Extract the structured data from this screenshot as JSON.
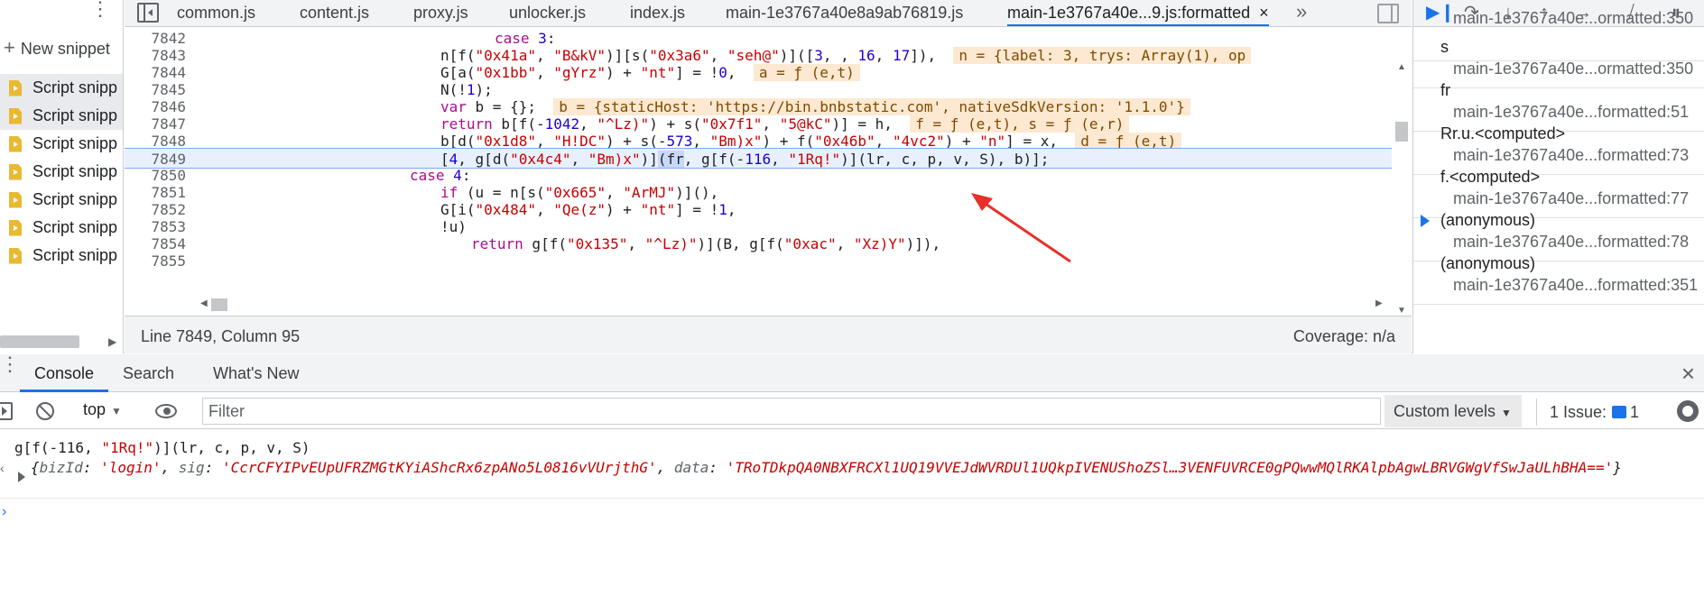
{
  "snippets": {
    "new_label": "New snippet",
    "items": [
      "Script snipp",
      "Script snipp",
      "Script snipp",
      "Script snipp",
      "Script snipp",
      "Script snipp",
      "Script snipp"
    ]
  },
  "editor": {
    "tabs": [
      {
        "label": "common.js"
      },
      {
        "label": "content.js"
      },
      {
        "label": "proxy.js"
      },
      {
        "label": "unlocker.js"
      },
      {
        "label": "index.js"
      },
      {
        "label": "main-1e3767a40e8a9ab76819.js"
      },
      {
        "label": "main-1e3767a40e...9.js:formatted",
        "active": true
      }
    ],
    "tab_close": "×",
    "tab_more": "»",
    "lines": [
      {
        "n": "7842",
        "indent": 21
      },
      {
        "n": "7843",
        "indent": 23
      },
      {
        "n": "7844",
        "indent": 23
      },
      {
        "n": "7845",
        "indent": 23
      },
      {
        "n": "7846",
        "indent": 23
      },
      {
        "n": "7847",
        "indent": 23
      },
      {
        "n": "7848",
        "indent": 23
      },
      {
        "n": "7849",
        "indent": 23
      },
      {
        "n": "7850",
        "indent": 21
      },
      {
        "n": "7851",
        "indent": 23
      },
      {
        "n": "7852",
        "indent": 23
      },
      {
        "n": "7853",
        "indent": 23
      },
      {
        "n": "7854",
        "indent": 25
      },
      {
        "n": "7855",
        "indent": 23
      }
    ],
    "code": {
      "l7842": {
        "kw": "case",
        "num": "3",
        "rest": ":"
      },
      "l7843": {
        "a": "n[f(",
        "s1": "\"0x41a\"",
        "b": ", ",
        "s2": "\"B&kV\"",
        "c": ")][s(",
        "s3": "\"0x3a6\"",
        "d": ", ",
        "s4": "\"seh@\"",
        "e": ")]([",
        "n1": "3",
        "f": ", , ",
        "n2": "16",
        "g": ", ",
        "n3": "17",
        "h": "]),  ",
        "inline": "n = {label: 3, trys: Array(1), op"
      },
      "l7844": {
        "a": "G[a(",
        "s1": "\"0x1bb\"",
        "b": ", ",
        "s2": "\"gYrz\"",
        "c": ") + ",
        "s3": "\"nt\"",
        "d": "] = !",
        "n1": "0",
        "e": ",  ",
        "inline": "a = ƒ (e,t)"
      },
      "l7845": {
        "a": "N(!",
        "n1": "1",
        "b": ");"
      },
      "l7846": {
        "kw": "var",
        "a": " b = {};  ",
        "inline": "b = {staticHost: 'https://bin.bnbstatic.com', nativeSdkVersion: '1.1.0'}"
      },
      "l7847": {
        "kw": "return",
        "a": " b[f(-",
        "n1": "1042",
        "b": ", ",
        "s1": "\"^Lz)\"",
        "c": ") + s(",
        "s2": "\"0x7f1\"",
        "d": ", ",
        "s3": "\"5@kC\"",
        "e": ")] = h,  ",
        "inline": "f = ƒ (e,t), s = ƒ (e,r)"
      },
      "l7848": {
        "a": "b[d(",
        "s1": "\"0x1d8\"",
        "b": ", ",
        "s2": "\"H!DC\"",
        "c": ") + s(-",
        "n1": "573",
        "d": ", ",
        "s3": "\"Bm)x\"",
        "e": ") + f(",
        "s4": "\"0x46b\"",
        "f": ", ",
        "s5": "\"4vc2\"",
        "g": ") + ",
        "s6": "\"n\"",
        "h": "] = x,  ",
        "inline": "d = ƒ (e,t)"
      },
      "l7849": {
        "a": "[",
        "n1": "4",
        "b": ", g[d(",
        "s1": "\"0x4c4\"",
        "c": ", ",
        "s2": "\"Bm)x\"",
        "d": ")]",
        "sel": "(fr",
        "e": ", g[f(-",
        "n2": "116",
        "f": ", ",
        "s3": "\"1Rq!\"",
        "g": ")](lr, c, p, v, S), b)];"
      },
      "l7850": {
        "kw": "case",
        "num": "4",
        "rest": ":"
      },
      "l7851": {
        "kw": "if",
        "a": " (u = n[s(",
        "s1": "\"0x665\"",
        "b": ", ",
        "s2": "\"ArMJ\"",
        "c": ")](),"
      },
      "l7852": {
        "a": "G[i(",
        "s1": "\"0x484\"",
        "b": ", ",
        "s2": "\"Qe(z\"",
        "c": ") + ",
        "s3": "\"nt\"",
        "d": "] = !",
        "n1": "1",
        "e": ","
      },
      "l7853": {
        "a": "!u)"
      },
      "l7854": {
        "kw": "return",
        "a": " g[f(",
        "s1": "\"0x135\"",
        "b": ", ",
        "s2": "\"^Lz)\"",
        "c": ")](B, g[f(",
        "s3": "\"0xac\"",
        "d": ", ",
        "s4": "\"Xz)Y\"",
        "e": ")]),"
      },
      "l7855": {
        "a": ""
      }
    },
    "status_position": "Line 7849, Column 95",
    "status_coverage": "Coverage: n/a"
  },
  "callstack": {
    "frames": [
      {
        "name": "",
        "loc": "main-1e3767a40e...ormatted:350"
      },
      {
        "name": "s",
        "loc": "main-1e3767a40e...ormatted:350"
      },
      {
        "name": "fr",
        "loc": "main-1e3767a40e...formatted:51"
      },
      {
        "name": "Rr.u.<computed>",
        "loc": "main-1e3767a40e...formatted:73"
      },
      {
        "name": "f.<computed>",
        "loc": "main-1e3767a40e...formatted:77"
      },
      {
        "name": "(anonymous)",
        "loc": "main-1e3767a40e...formatted:78",
        "current": true
      },
      {
        "name": "(anonymous)",
        "loc": "main-1e3767a40e...formatted:351"
      }
    ]
  },
  "drawer": {
    "tabs": [
      "Console",
      "Search",
      "What's New"
    ],
    "active_tab": "Console",
    "close": "×",
    "toolbar": {
      "context": "top",
      "filter_placeholder": "Filter",
      "levels": "Custom levels",
      "issues_label": "1 Issue:",
      "issues_count": "1"
    },
    "command": {
      "a": "g[f(-116, ",
      "s": "\"1Rq!\"",
      "b": ")](lr, c, p, v, S)"
    },
    "result": {
      "open": "{",
      "k1": "bizId",
      "v1": "'login'",
      "k2": "sig",
      "v2": "'CcrCFYIPvEUpUFRZMGtKYiAShcRx6zpANo5L0816vVUrjthG'",
      "k3": "data",
      "v3": "'TRoTDkpQA0NBXFRCXl1UQ19VVEJdWVRDUl1UQkpIVENUShoZSl…3VENFUVRCE0gPQwwMQlRKAlpbAgwLBRVGWgVfSwJaULhBHA=='",
      "close": "}"
    },
    "prompt": "›"
  },
  "colors": {
    "accent": "#1a73e8",
    "string": "#c80000",
    "keyword": "#a90d91",
    "number": "#1c00cf",
    "annotation_arrow": "#e8302a"
  }
}
